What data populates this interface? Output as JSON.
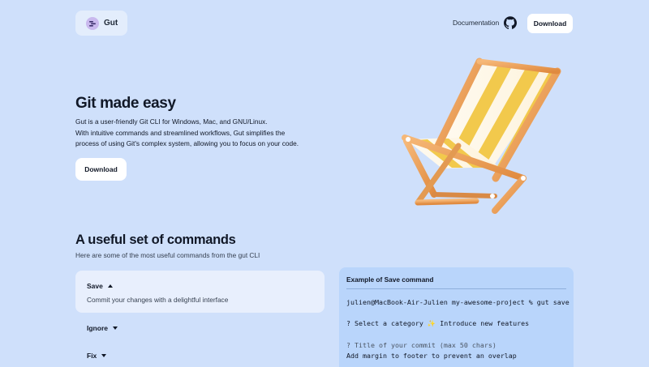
{
  "header": {
    "logo_text": "Gut",
    "nav_documentation": "Documentation",
    "download_label": "Download"
  },
  "hero": {
    "title": "Git made easy",
    "lines": [
      "Gut is a user-friendly Git CLI for Windows, Mac, and GNU/Linux.",
      "With intuitive commands and streamlined workflows, Gut simplifies the",
      "process of using Git's complex system, allowing you to focus on your code."
    ],
    "download_label": "Download"
  },
  "commands": {
    "title": "A useful set of commands",
    "subtitle": "Here are some of the most useful commands from the gut CLI",
    "items": [
      {
        "label": "Save",
        "description": "Commit your changes with a delightful interface",
        "expanded": true
      },
      {
        "label": "Ignore",
        "expanded": false
      },
      {
        "label": "Fix",
        "expanded": false
      }
    ]
  },
  "example": {
    "title": "Example of Save command",
    "prompt": "julien@MacBook-Air-Julien my-awesome-project % gut save",
    "category_prompt": "? Select a category",
    "category_value": "Introduce new features",
    "commit_prompt": "? Title of your commit (max 50 chars)",
    "commit_value": "Add margin to footer to prevent an overlap"
  },
  "colors": {
    "background": "#cfe0fb",
    "button_bg": "#ffffff",
    "example_bg": "#b9d5fb",
    "chair_wood": "#f0a45c",
    "chair_stripe_yellow": "#f2c94c"
  },
  "icons": [
    "gut-logo-icon",
    "github-icon",
    "caret-up-icon",
    "caret-down-icon",
    "beach-chair-illustration"
  ]
}
